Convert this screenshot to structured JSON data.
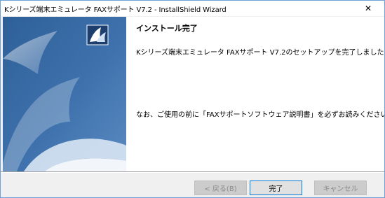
{
  "window": {
    "title": "Kシリーズ端末エミュレータ FAXサポート V7.2 - InstallShield Wizard",
    "close_glyph": "✕"
  },
  "main": {
    "heading": "インストール完了",
    "message_line1": "Kシリーズ端末エミュレータ FAXサポート V7.2のセットアップを完了しました。",
    "message_line2": "なお、ご使用の前に「FAXサポートソフトウェア説明書」を必ずお読みください。"
  },
  "buttons": {
    "back_label": "< 戻る(B)",
    "finish_label": "完了",
    "cancel_label": "キャンセル"
  },
  "colors": {
    "accent_border": "#0078d7",
    "panel_blue": "#3f6ea6"
  }
}
